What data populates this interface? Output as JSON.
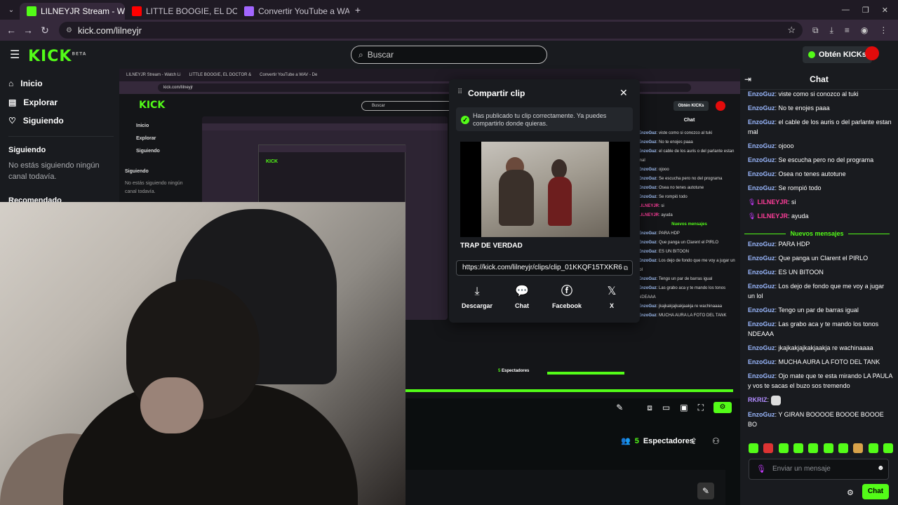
{
  "browser": {
    "tabs": [
      {
        "title": "LILNEYJR Stream - Watch Li"
      },
      {
        "title": "LITTLE BOOGIE, EL DOCTOR &"
      },
      {
        "title": "Convertir YouTube a WAV - De"
      }
    ],
    "url": "kick.com/lilneyjr"
  },
  "header": {
    "logo": "KICK",
    "logo_beta": "BETA",
    "search_placeholder": "Buscar",
    "get_kicks": "Obtén KICKs"
  },
  "sidebar": {
    "items": [
      {
        "label": "Inicio",
        "icon": "home-icon"
      },
      {
        "label": "Explorar",
        "icon": "browse-icon"
      },
      {
        "label": "Siguiendo",
        "icon": "heart-icon"
      }
    ],
    "following_heading": "Siguiendo",
    "following_empty": "No estás siguiendo ningún canal todavía.",
    "recommended_heading": "Recomendado"
  },
  "modal": {
    "title": "Compartir clip",
    "success_message": "Has publicado tu clip correctamente. Ya puedes compartirlo donde quieras.",
    "clip_title": "TRAP DE VERDAD",
    "clip_url": "https://kick.com/lilneyjr/clips/clip_01KKQF15TXKR6",
    "share_options": [
      {
        "label": "Descargar",
        "icon": "download-icon"
      },
      {
        "label": "Chat",
        "icon": "chat-bubble-icon"
      },
      {
        "label": "Facebook",
        "icon": "facebook-icon"
      },
      {
        "label": "X",
        "icon": "x-logo-icon"
      }
    ]
  },
  "stream": {
    "viewers_count": "5",
    "viewers_label": "Espectadores"
  },
  "chat": {
    "title": "Chat",
    "new_messages_label": "Nuevos mensajes",
    "messages_before": [
      {
        "user": "EnzoGuz",
        "text": "viste como si conozco al tuki"
      },
      {
        "user": "EnzoGuz",
        "text": "No te enojes paaa"
      },
      {
        "user": "EnzoGuz",
        "text": "el cable de los auris o del parlante estan mal"
      },
      {
        "user": "EnzoGuz",
        "text": "ojooo"
      },
      {
        "user": "EnzoGuz",
        "text": "Se escucha pero no del programa"
      },
      {
        "user": "EnzoGuz",
        "text": "Osea no tenes autotune"
      },
      {
        "user": "EnzoGuz",
        "text": "Se rompió todo"
      },
      {
        "user": "LILNEYJR",
        "text": "si"
      },
      {
        "user": "LILNEYJR",
        "text": "ayuda"
      }
    ],
    "messages_after": [
      {
        "user": "EnzoGuz",
        "text": "PARA HDP"
      },
      {
        "user": "EnzoGuz",
        "text": "Que panga un Clarent el PIRLO"
      },
      {
        "user": "EnzoGuz",
        "text": "ES UN BITOON"
      },
      {
        "user": "EnzoGuz",
        "text": "Los dejo de fondo que me voy a jugar un lol"
      },
      {
        "user": "EnzoGuz",
        "text": "Tengo un par de barras igual"
      },
      {
        "user": "EnzoGuz",
        "text": "Las grabo aca y te mando los tonos NDEAAA"
      },
      {
        "user": "EnzoGuz",
        "text": "jkajkakjajkakjaakja re wachinaaaa"
      },
      {
        "user": "EnzoGuz",
        "text": "MUCHA AURA LA FOTO DEL TANK"
      },
      {
        "user": "EnzoGuz",
        "text": "Ojo mate que te esta mirando LA PAULA y vos te sacas el buzo sos tremendo"
      },
      {
        "user": "RKRIZ",
        "text": ""
      },
      {
        "user": "EnzoGuz",
        "text": "Y GIRAN BOOOOE BOOOE BOOOE BO"
      }
    ],
    "input_placeholder": "Enviar un mensaje",
    "send_label": "Chat"
  },
  "colors": {
    "kick_green": "#53fc18",
    "username_blue": "#9ab8ff",
    "broadcaster_pink": "#ff3d9a"
  }
}
